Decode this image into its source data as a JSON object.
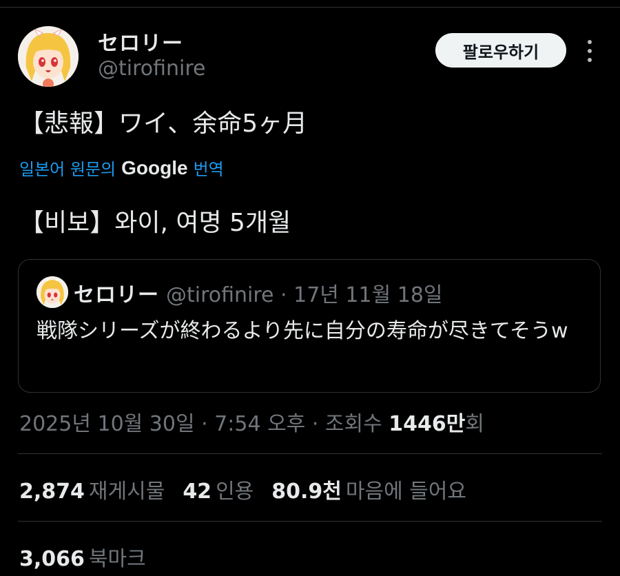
{
  "author": {
    "display_name": "セロリー",
    "handle": "@tirofinire"
  },
  "follow_button": "팔로우하기",
  "tweet": {
    "text": "【悲報】ワイ、余命5ヶ月",
    "translate_prefix": "일본어 원문의",
    "translate_brand": "Google",
    "translate_suffix": "번역",
    "translated_text": "【비보】와이, 여명 5개월"
  },
  "quote": {
    "display_name": "セロリー",
    "meta": "@tirofinire · 17년 11월 18일",
    "text": "戦隊シリーズが終わるより先に自分の寿命が尽きてそうw"
  },
  "timestamp": {
    "prefix": "2025년 10월 30일 · 7:54 오후 · 조회수 ",
    "views": "1446만",
    "suffix": "회"
  },
  "stats": {
    "reposts": {
      "count": "2,874",
      "label": "재게시물"
    },
    "quotes": {
      "count": "42",
      "label": "인용"
    },
    "likes": {
      "count": "80.9천",
      "label": "마음에 들어요"
    },
    "bookmarks": {
      "count": "3,066",
      "label": "북마크"
    }
  },
  "icons": {
    "avatar": "anime-girl-avatar",
    "more": "more-vertical-icon"
  },
  "colors": {
    "background": "#000000",
    "text": "#e7e9ea",
    "secondary": "#71767b",
    "link": "#1d9bf0",
    "border": "#2f3336",
    "button_bg": "#eff3f4"
  }
}
